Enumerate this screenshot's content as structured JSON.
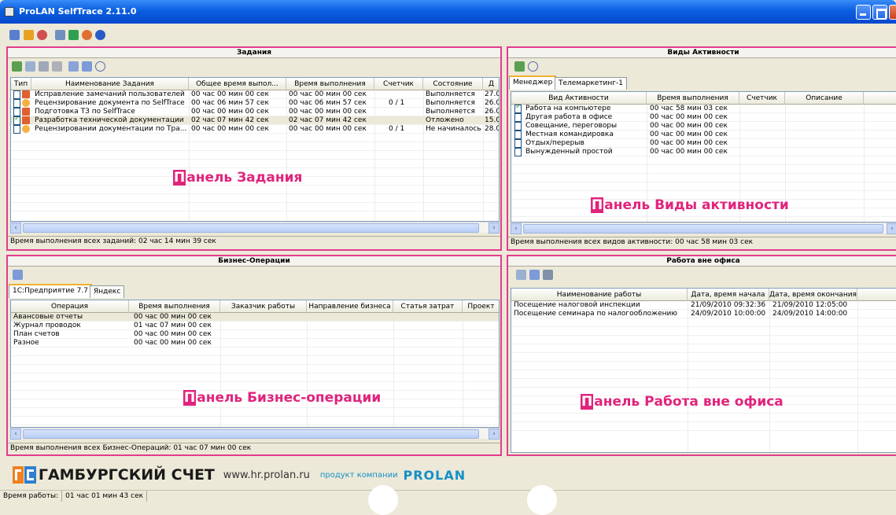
{
  "window": {
    "title": "ProLAN SelfTrace 2.11.0"
  },
  "tasks": {
    "header": "Задания",
    "columns": [
      "Тип",
      "Наименование Задания",
      "Общее время выпол...",
      "Время выполнения",
      "Счетчик",
      "Состояние",
      "Д"
    ],
    "rows": [
      {
        "checked": false,
        "icon": "warning-user-icon",
        "name": "Исправление замечаний пользователей",
        "total": "00 час 00 мин 00 сек",
        "time": "00 час 00 мин 00 сек",
        "counter": "",
        "state": "Выполняется",
        "d": "27.0"
      },
      {
        "checked": false,
        "icon": "clock-icon",
        "name": "Рецензирование документа по SelfTrace",
        "total": "00 час 06 мин 57 сек",
        "time": "00 час 06 мин 57 сек",
        "counter": "0 / 1",
        "state": "Выполняется",
        "d": "26.0"
      },
      {
        "checked": false,
        "icon": "warning-user-icon",
        "name": "Подготовка ТЗ по SelfTrace",
        "total": "00 час 00 мин 00 сек",
        "time": "00 час 00 мин 00 сек",
        "counter": "",
        "state": "Выполняется",
        "d": "26.0"
      },
      {
        "checked": true,
        "icon": "user-icon",
        "name": "Разработка технической документации",
        "total": "02 час 07 мин 42 сек",
        "time": "02 час 07 мин 42 сек",
        "counter": "",
        "state": "Отложено",
        "d": "15.0"
      },
      {
        "checked": false,
        "icon": "clock-icon",
        "name": "Рецензировании документации по Тра...",
        "total": "00 час 00 мин 00 сек",
        "time": "00 час 00 мин 00 сек",
        "counter": "0 / 1",
        "state": "Не начиналось",
        "d": "28.0"
      }
    ],
    "status": "Время выполнения всех заданий: 02 час 14 мин 39 сек",
    "overlay_cap": "П",
    "overlay_rest": "анель Задания"
  },
  "activities": {
    "header": "Виды Активности",
    "tabs": [
      "Менеджер",
      "Телемаркетинг-1"
    ],
    "columns": [
      "Вид Активности",
      "Время выполнения",
      "Счетчик",
      "Описание"
    ],
    "rows": [
      {
        "checked": true,
        "name": "Работа на компьютере",
        "time": "00 час 58 мин 03 сек"
      },
      {
        "checked": false,
        "name": "Другая работа в офисе",
        "time": "00 час 00 мин 00 сек"
      },
      {
        "checked": false,
        "name": "Совещание, переговоры",
        "time": "00 час 00 мин 00 сек"
      },
      {
        "checked": false,
        "name": "Местная командировка",
        "time": "00 час 00 мин 00 сек"
      },
      {
        "checked": false,
        "name": "Отдых/перерыв",
        "time": "00 час 00 мин 00 сек"
      },
      {
        "checked": false,
        "name": "Вынужденный простой",
        "time": "00 час 00 мин 00 сек"
      }
    ],
    "status": "Время выполнения всех видов активности: 00 час 58 мин 03 сек",
    "overlay_cap": "П",
    "overlay_rest": "анель Виды активности"
  },
  "business": {
    "header": "Бизнес-Операции",
    "tabs": [
      "1С:Предприятие 7.7",
      "Яндекс"
    ],
    "columns": [
      "Операция",
      "Время выполнения",
      "Заказчик работы",
      "Направление бизнеса",
      "Статья затрат",
      "Проект"
    ],
    "rows": [
      {
        "name": "Авансовые отчеты",
        "time": "00 час 00 мин 00 сек"
      },
      {
        "name": "Журнал проводок",
        "time": "01 час 07 мин 00 сек"
      },
      {
        "name": "План счетов",
        "time": "00 час 00 мин 00 сек"
      },
      {
        "name": "Разное",
        "time": "00 час 00 мин 00 сек"
      }
    ],
    "status": "Время выполнения всех Бизнес-Операций: 01 час 07 мин 00 сек",
    "overlay_cap": "П",
    "overlay_rest": "анель Бизнес-операции"
  },
  "outside": {
    "header": "Работа вне офиса",
    "columns": [
      "Наименование работы",
      "Дата, время начала",
      "Дата, время окончания"
    ],
    "rows": [
      {
        "name": "Посещение налоговой инспекции",
        "start": "21/09/2010 09:32:36",
        "end": "21/09/2010 12:05:00"
      },
      {
        "name": "Посещение семинара по налогообложению",
        "start": "24/09/2010 10:00:00",
        "end": "24/09/2010 14:00:00"
      }
    ],
    "overlay_cap": "П",
    "overlay_rest": "анель Работа вне офиса"
  },
  "logo": {
    "name": "ГАМБУРГСКИЙ СЧЕТ",
    "url": "www.hr.prolan.ru",
    "product": "продукт компании",
    "brand": "PROLAN"
  },
  "footer": {
    "label": "Время работы:",
    "value": "01 час 01 мин 43 сек"
  },
  "colors": {
    "accent": "#e23c8c",
    "titlebar": "#0a5fe0",
    "brand": "#1590c8"
  }
}
